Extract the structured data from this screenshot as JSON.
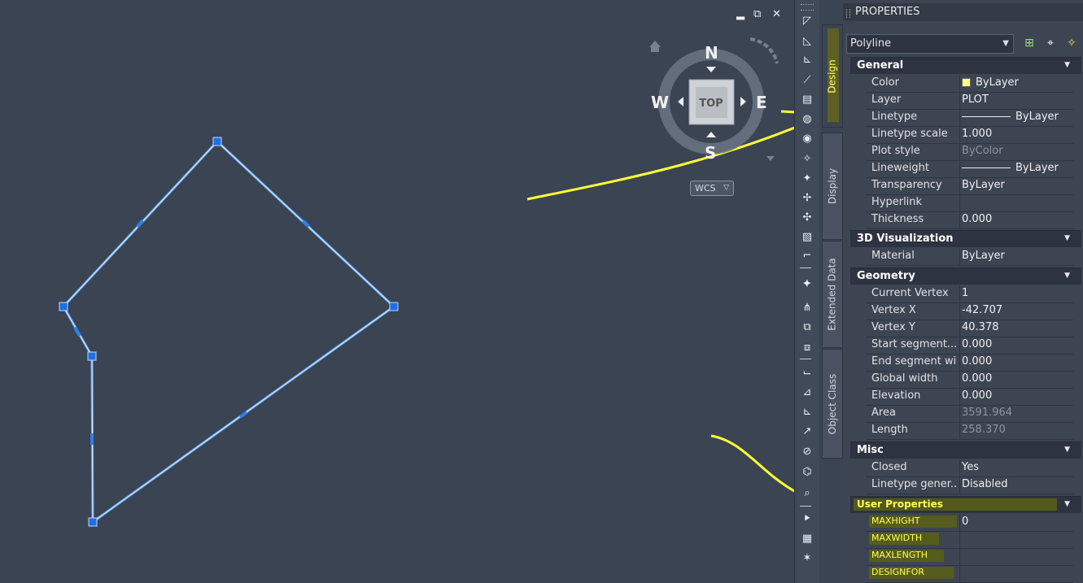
{
  "viewport": {
    "viewcube": {
      "north": "N",
      "south": "S",
      "east": "E",
      "west": "W",
      "face": "TOP"
    },
    "wcs_label": "WCS",
    "window_controls": {
      "minimize": "▂",
      "restore": "⧉",
      "close": "✕"
    },
    "highlight_color": "#ffff33",
    "polyline_color": "#6ab2ff"
  },
  "toolbar": {
    "icons": [
      "match-properties-icon",
      "measure-icon",
      "dim-icon",
      "arrow-icon",
      "layout-icon",
      "globe-icon",
      "globe2-icon",
      "snap-icon",
      "snap-a-icon",
      "snap-select-icon",
      "snap-zoom-icon",
      "region-icon",
      "tool-icon",
      "move-icon",
      "split-icon",
      "stack-icon",
      "stack2-icon",
      "grid-icon",
      "grid2-icon",
      "grid3-icon",
      "draw-icon",
      "eraser-icon",
      "paint-icon",
      "query-icon",
      "select-icon",
      "print-icon",
      "wand-icon"
    ]
  },
  "tabs": [
    "Design",
    "Display",
    "Extended Data",
    "Object Class"
  ],
  "panel": {
    "title": "PROPERTIES",
    "object_type": "Polyline",
    "sections": {
      "general": {
        "title": "General",
        "rows": [
          {
            "k": "Color",
            "v": "ByLayer"
          },
          {
            "k": "Layer",
            "v": "PLOT"
          },
          {
            "k": "Linetype",
            "v": "ByLayer"
          },
          {
            "k": "Linetype scale",
            "v": "1.000"
          },
          {
            "k": "Plot style",
            "v": "ByColor"
          },
          {
            "k": "Lineweight",
            "v": "ByLayer"
          },
          {
            "k": "Transparency",
            "v": "ByLayer"
          },
          {
            "k": "Hyperlink",
            "v": ""
          },
          {
            "k": "Thickness",
            "v": "0.000"
          }
        ]
      },
      "viz": {
        "title": "3D Visualization",
        "rows": [
          {
            "k": "Material",
            "v": "ByLayer"
          }
        ]
      },
      "geometry": {
        "title": "Geometry",
        "rows": [
          {
            "k": "Current Vertex",
            "v": "1"
          },
          {
            "k": "Vertex X",
            "v": "-42.707"
          },
          {
            "k": "Vertex Y",
            "v": "40.378"
          },
          {
            "k": "Start  segment...",
            "v": "0.000"
          },
          {
            "k": "End segment wi...",
            "v": "0.000"
          },
          {
            "k": "Global width",
            "v": "0.000"
          },
          {
            "k": "Elevation",
            "v": "0.000"
          },
          {
            "k": "Area",
            "v": "3591.964"
          },
          {
            "k": "Length",
            "v": "258.370"
          }
        ]
      },
      "misc": {
        "title": "Misc",
        "rows": [
          {
            "k": "Closed",
            "v": "Yes"
          },
          {
            "k": "Linetype  gener...",
            "v": "Disabled"
          }
        ]
      },
      "user": {
        "title": "User Properties",
        "rows": [
          {
            "k": "MAXHIGHT",
            "v": "0"
          },
          {
            "k": "MAXWIDTH",
            "v": ""
          },
          {
            "k": "MAXLENGTH",
            "v": ""
          },
          {
            "k": "DESIGNFOR",
            "v": ""
          }
        ]
      }
    }
  }
}
